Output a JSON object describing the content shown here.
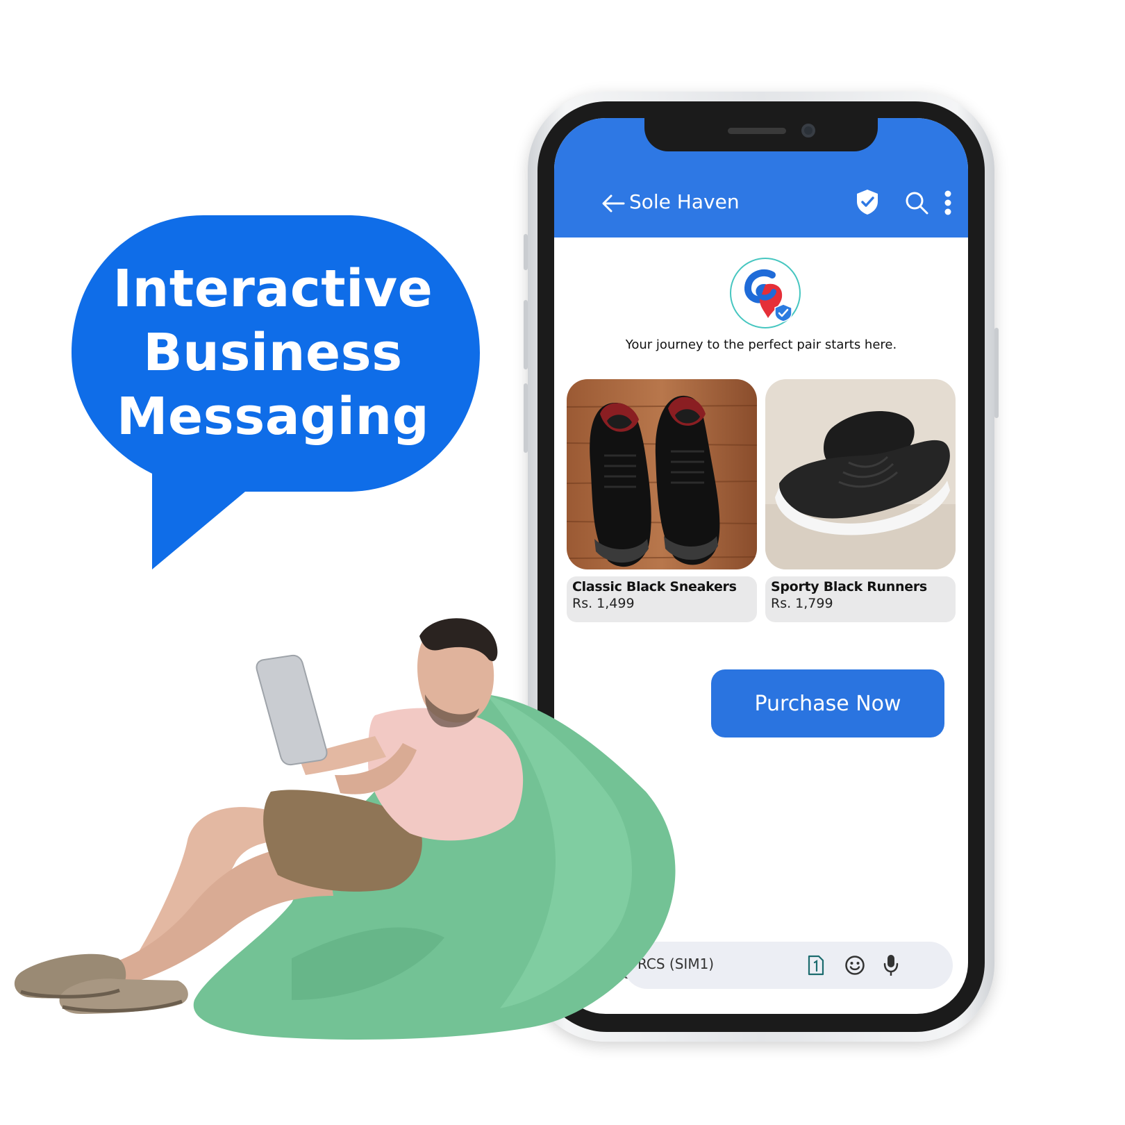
{
  "headline": {
    "lines": [
      "Interactive",
      "Business",
      "Messaging"
    ]
  },
  "app": {
    "title": "Sole Haven",
    "tagline": "Your journey to the perfect pair starts here.",
    "accent": "#2e78e4"
  },
  "products": [
    {
      "name": "Classic Black Sneakers",
      "price": "Rs. 1,499"
    },
    {
      "name": "Sporty Black Runners",
      "price": "Rs. 1,799"
    }
  ],
  "actions": {
    "purchase_label": "Purchase Now"
  },
  "composer": {
    "placeholder": "RCS (SIM1)"
  },
  "icons": [
    "back-arrow-icon",
    "verified-shield-icon",
    "search-icon",
    "more-vertical-icon",
    "sim-card-icon",
    "emoji-icon",
    "microphone-icon",
    "attachment-icon"
  ]
}
